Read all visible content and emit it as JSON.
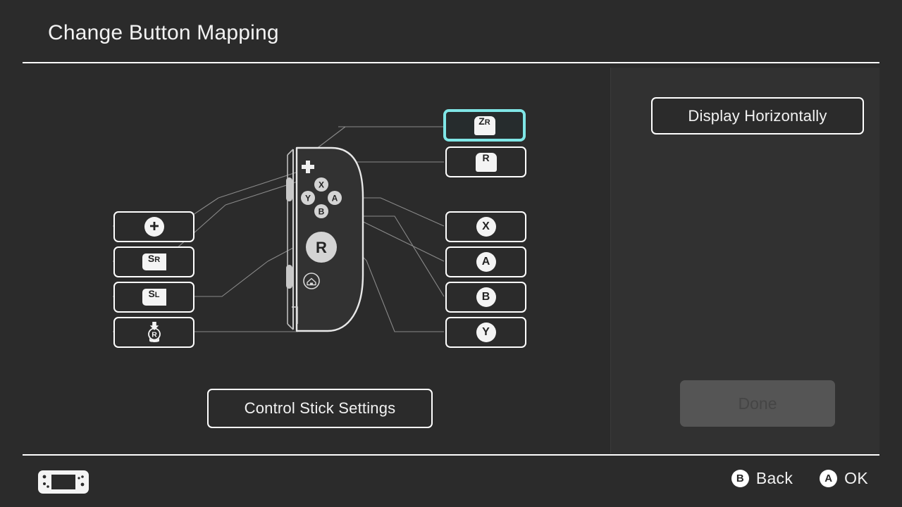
{
  "header": {
    "title": "Change Button Mapping"
  },
  "left_panel": {
    "left_mappings": [
      {
        "id": "plus",
        "glyph_type": "plus",
        "label": "+",
        "sub": "",
        "icon_name": "plus-button-icon"
      },
      {
        "id": "sr",
        "glyph_type": "shoulder",
        "label": "S",
        "sub": "R",
        "icon_name": "sr-button-icon"
      },
      {
        "id": "sl",
        "glyph_type": "shoulder",
        "label": "S",
        "sub": "L",
        "icon_name": "sl-button-icon"
      },
      {
        "id": "stick-press",
        "glyph_type": "stick",
        "label": "R",
        "sub": "",
        "icon_name": "right-stick-press-icon"
      }
    ],
    "right_mappings": [
      {
        "id": "zr",
        "glyph_type": "trigger",
        "label": "Z",
        "sub": "R",
        "icon_name": "zr-trigger-icon",
        "selected": true
      },
      {
        "id": "r",
        "glyph_type": "trigger",
        "label": "R",
        "sub": "",
        "icon_name": "r-trigger-icon",
        "selected": false
      },
      {
        "id": "x",
        "glyph_type": "circle",
        "label": "X",
        "sub": "",
        "icon_name": "x-button-icon",
        "selected": false
      },
      {
        "id": "a",
        "glyph_type": "circle",
        "label": "A",
        "sub": "",
        "icon_name": "a-button-icon",
        "selected": false
      },
      {
        "id": "b",
        "glyph_type": "circle",
        "label": "B",
        "sub": "",
        "icon_name": "b-button-icon",
        "selected": false
      },
      {
        "id": "y",
        "glyph_type": "circle",
        "label": "Y",
        "sub": "",
        "icon_name": "y-button-icon",
        "selected": false
      }
    ],
    "control_stick_settings_label": "Control Stick Settings",
    "controller": {
      "name": "right-joy-con",
      "face_buttons": [
        "X",
        "Y",
        "A",
        "B"
      ],
      "stick_label": "R",
      "plus_label": "+",
      "home_icon": "home-button-icon"
    }
  },
  "right_panel": {
    "display_horizontally_label": "Display Horizontally",
    "done_label": "Done",
    "done_disabled": true
  },
  "footer": {
    "console_icon": "switch-console-icon",
    "hints": [
      {
        "button": "B",
        "label": "Back"
      },
      {
        "button": "A",
        "label": "OK"
      }
    ]
  },
  "colors": {
    "background": "#2b2b2b",
    "panel_background": "#313131",
    "accent_highlight": "#7fe6e6",
    "text": "#f2f2f2",
    "disabled_fill": "#555555",
    "disabled_text": "#454545",
    "line": "#8a8a8a"
  }
}
